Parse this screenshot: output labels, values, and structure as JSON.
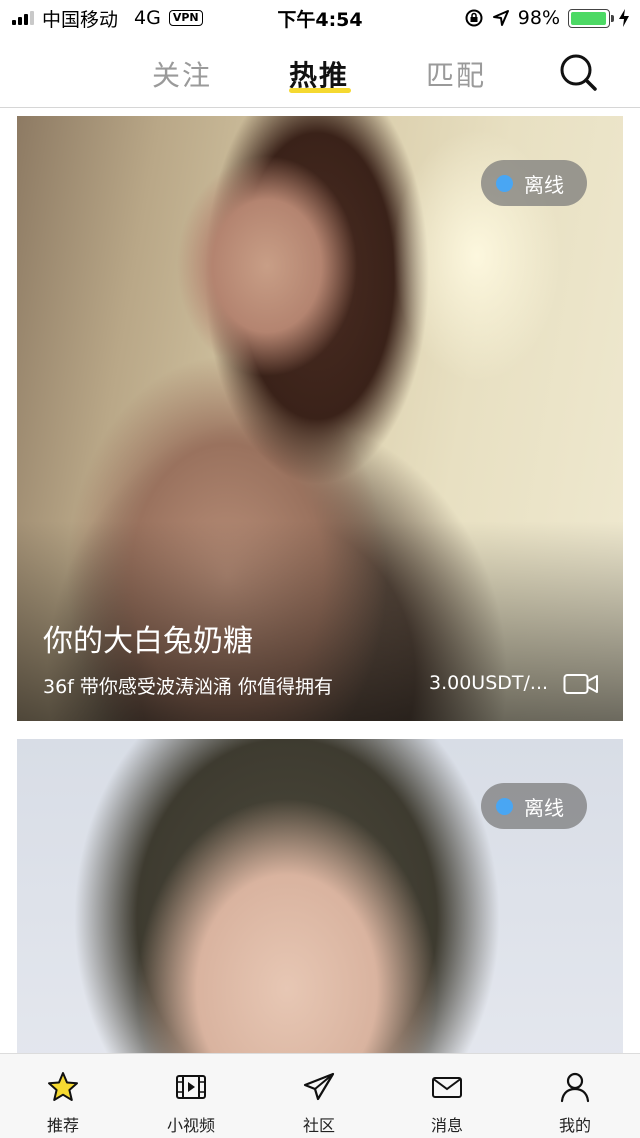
{
  "status_bar": {
    "carrier": "中国移动",
    "network": "4G",
    "vpn": "VPN",
    "time": "下午4:54",
    "battery": "98%",
    "battery_level": 0.98
  },
  "top_tabs": [
    {
      "label": "关注",
      "active": false
    },
    {
      "label": "热推",
      "active": true
    },
    {
      "label": "匹配",
      "active": false
    }
  ],
  "cards": [
    {
      "status": "离线",
      "name": "你的大白兔奶糖",
      "description": "36f 带你感受波涛汹涌 你值得拥有",
      "price": "3.00USDT/..."
    },
    {
      "status": "离线"
    }
  ],
  "colors": {
    "accent": "#f5d931",
    "status_dot": "#49a6f3",
    "battery": "#4cd964"
  },
  "bottom_tabs": [
    {
      "label": "推荐",
      "icon": "star-icon",
      "active": true
    },
    {
      "label": "小视频",
      "icon": "film-icon",
      "active": false
    },
    {
      "label": "社区",
      "icon": "paper-plane-icon",
      "active": false
    },
    {
      "label": "消息",
      "icon": "envelope-icon",
      "active": false
    },
    {
      "label": "我的",
      "icon": "person-icon",
      "active": false
    }
  ]
}
